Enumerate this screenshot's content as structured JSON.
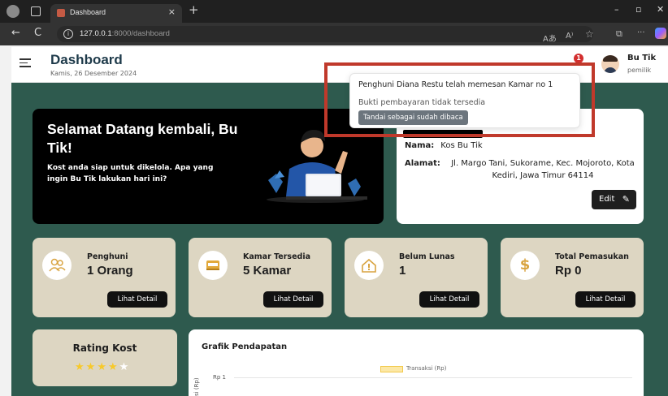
{
  "browser": {
    "tab_title": "Dashboard",
    "tab_close": "×",
    "new_tab": "+",
    "url_host": "127.0.0.1",
    "url_path": ":8000/dashboard",
    "win_min": "–",
    "win_max": "▫",
    "win_close": "✕",
    "back": "←",
    "reload": "C",
    "read_aloud": "Aあ",
    "immersive": "A⁾",
    "favorite": "☆",
    "collections": "⧉",
    "more": "···"
  },
  "header": {
    "title": "Dashboard",
    "date": "Kamis, 26 Desember 2024",
    "notification_count": "1",
    "user_name": "Bu Tik",
    "user_role": "pemilik"
  },
  "welcome": {
    "heading": "Selamat Datang kembali, Bu Tik!",
    "text": "Kost anda siap untuk dikelola. Apa yang ingin Bu Tik lakukan hari ini?"
  },
  "profile": {
    "nama_label": "Nama:",
    "nama_value": "Kos Bu Tik",
    "alamat_label": "Alamat:",
    "alamat_value": "Jl. Margo Tani, Sukorame, Kec. Mojoroto, Kota Kediri, Jawa Timur 64114",
    "edit_label": "Edit"
  },
  "stats": [
    {
      "label": "Penghuni",
      "value": "1 Orang",
      "icon": "users-icon",
      "button": "Lihat Detail"
    },
    {
      "label": "Kamar Tersedia",
      "value": "5 Kamar",
      "icon": "bed-icon",
      "button": "Lihat Detail"
    },
    {
      "label": "Belum Lunas",
      "value": "1",
      "icon": "house-alert-icon",
      "button": "Lihat Detail"
    },
    {
      "label": "Total Pemasukan",
      "value": "Rp 0",
      "icon": "dollar-icon",
      "button": "Lihat Detail"
    }
  ],
  "rating": {
    "title": "Rating Kost",
    "stars_filled": 4,
    "stars_total": 5
  },
  "grafik": {
    "title": "Grafik Pendapatan",
    "legend": "Transaksi (Rp)",
    "ytick": "Rp 1",
    "ylabel": "ksi (Rp)"
  },
  "notification": {
    "message": "Penghuni Diana Restu telah memesan Kamar no 1",
    "detail": "Bukti pembayaran tidak tersedia",
    "mark_read": "Tandai sebagai sudah dibaca"
  },
  "colors": {
    "accent_green": "#2e5a4e",
    "card_beige": "#ddd6c2",
    "highlight_red": "#c0392b",
    "star_yellow": "#f7c92a"
  }
}
